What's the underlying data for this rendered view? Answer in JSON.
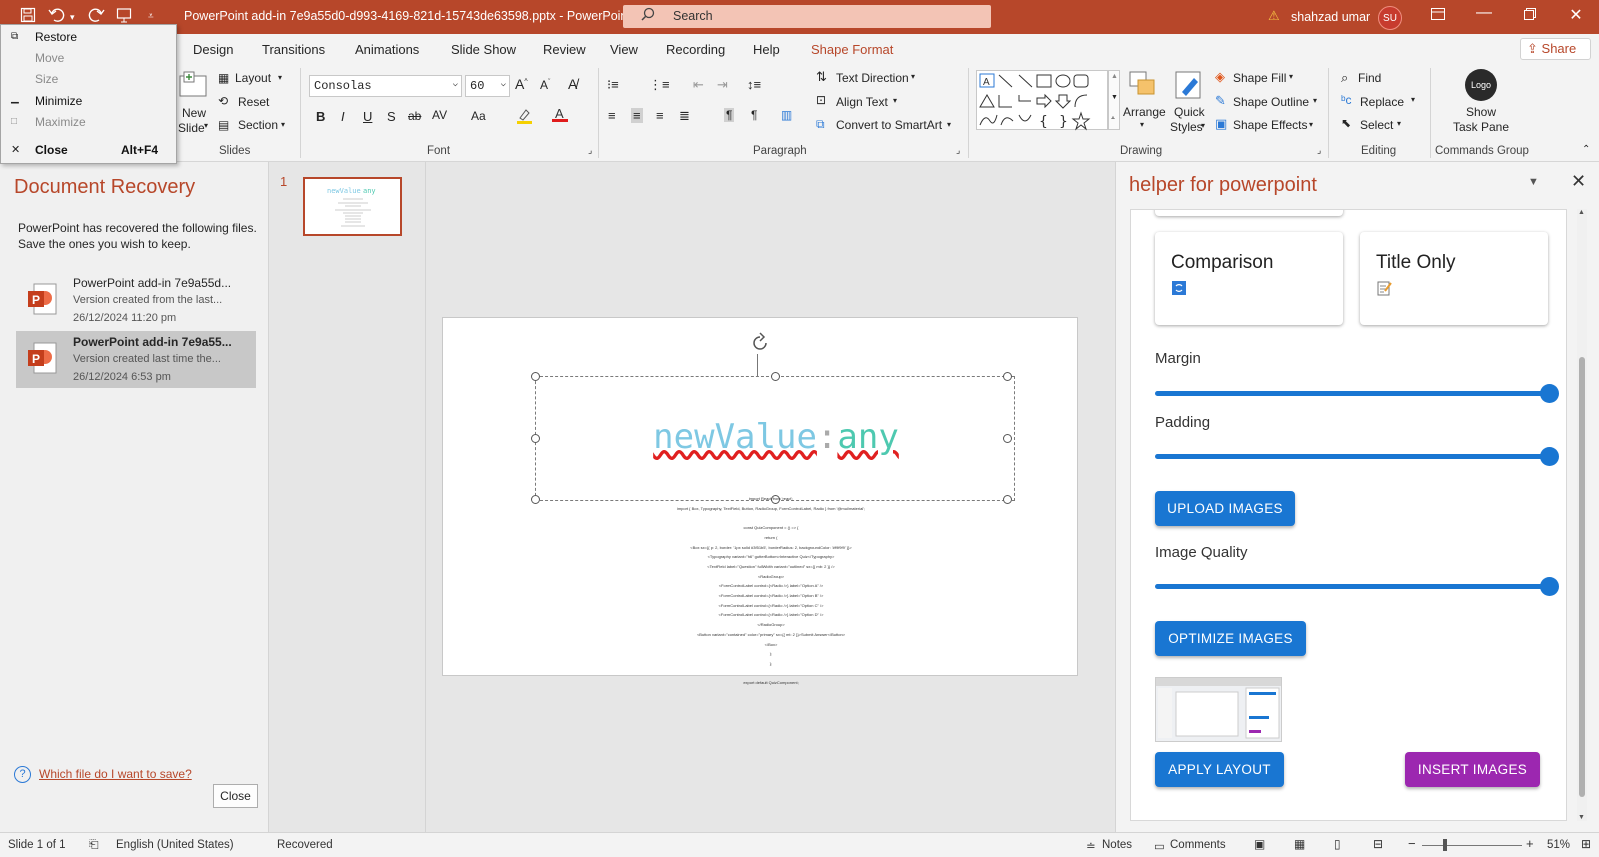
{
  "window": {
    "title": "PowerPoint add-in 7e9a55d0-d993-4169-821d-15743de63598.pptx  -  PowerPoint",
    "search_placeholder": "Search",
    "user_name": "shahzad umar",
    "user_initials": "SU",
    "accent_color": "#b7472a"
  },
  "system_menu": {
    "items": [
      {
        "label": "Restore",
        "accel": "",
        "enabled": true
      },
      {
        "label": "Move",
        "accel": "",
        "enabled": false
      },
      {
        "label": "Size",
        "accel": "",
        "enabled": false
      },
      {
        "label": "Minimize",
        "accel": "",
        "enabled": true
      },
      {
        "label": "Maximize",
        "accel": "",
        "enabled": false
      },
      {
        "label": "Close",
        "accel": "Alt+F4",
        "enabled": true
      }
    ]
  },
  "tabs": [
    {
      "label": "Design"
    },
    {
      "label": "Transitions"
    },
    {
      "label": "Animations"
    },
    {
      "label": "Slide Show"
    },
    {
      "label": "Review"
    },
    {
      "label": "View"
    },
    {
      "label": "Recording"
    },
    {
      "label": "Help"
    },
    {
      "label": "Shape Format"
    }
  ],
  "share_label": "Share",
  "ribbon": {
    "slides": {
      "new_slide": "New",
      "new_slide2": "Slide",
      "layout": "Layout",
      "reset": "Reset",
      "section": "Section",
      "group": "Slides"
    },
    "font": {
      "font_name": "Consolas",
      "font_size": "60",
      "group": "Font"
    },
    "paragraph": {
      "text_direction": "Text Direction",
      "align_text": "Align Text",
      "convert_smartart": "Convert to SmartArt",
      "group": "Paragraph"
    },
    "drawing": {
      "arrange": "Arrange",
      "quick_styles": "Quick",
      "quick_styles2": "Styles",
      "shape_fill": "Shape Fill",
      "shape_outline": "Shape Outline",
      "shape_effects": "Shape Effects",
      "group": "Drawing"
    },
    "editing": {
      "find": "Find",
      "replace": "Replace",
      "select": "Select",
      "group": "Editing"
    },
    "commands": {
      "logo": "Logo",
      "show": "Show",
      "task_pane": "Task Pane",
      "group": "Commands Group"
    }
  },
  "recovery": {
    "title": "Document Recovery",
    "description": "PowerPoint has recovered the following files.  Save the ones you wish to keep.",
    "files": [
      {
        "name": "PowerPoint add-in 7e9a55d...",
        "desc": "Version created from the last...",
        "date": "26/12/2024 11:20 pm"
      },
      {
        "name": "PowerPoint add-in 7e9a55...",
        "desc": "Version created last time the...",
        "date": "26/12/2024 6:53 pm"
      }
    ],
    "help_link": "Which file do I want to save?",
    "close_label": "Close"
  },
  "thumbnail": {
    "number": "1"
  },
  "slide": {
    "title_part1": "newValue",
    "title_colon": ":",
    "title_part2": "any",
    "code_lines": [
      "import React from 'react';",
      "import { Box, Typography, TextField, Button, RadioGroup, FormControlLabel, Radio } from '@mui/material';",
      "",
      "const QuizComponent = () => {",
      "return (",
      "<Box sx={{ p: 2, border: '1px solid #3f51b5', borderRadius: 2, backgroundColor: '#f9f9f9' }}>",
      "<Typography variant=\"h6\" gutterBottom>Interactive Quiz</Typography>",
      "<TextField label=\"Question\" fullWidth variant=\"outlined\" sx={{ mb: 2 }} />",
      "<RadioGroup>",
      "<FormControlLabel control={<Radio />} label=\"Option A\" />",
      "<FormControlLabel control={<Radio />} label=\"Option B\" />",
      "<FormControlLabel control={<Radio />} label=\"Option C\" />",
      "<FormControlLabel control={<Radio />} label=\"Option D\" />",
      "</RadioGroup>",
      "<Button variant=\"contained\" color=\"primary\" sx={{ mt: 2 }}>Submit Answer</Button>",
      "</Box>",
      ");",
      "};",
      "",
      "export default QuizComponent;"
    ]
  },
  "taskpane": {
    "title": "helper for powerpoint",
    "layout_cards": [
      {
        "label": "Comparison"
      },
      {
        "label": "Title Only"
      }
    ],
    "sliders": [
      {
        "label": "Margin",
        "value_fraction": 1.0
      },
      {
        "label": "Padding",
        "value_fraction": 1.0
      },
      {
        "label": "Image Quality",
        "value_fraction": 1.0
      }
    ],
    "upload_button": "UPLOAD IMAGES",
    "optimize_button": "OPTIMIZE IMAGES",
    "apply_button": "APPLY LAYOUT",
    "insert_button": "INSERT IMAGES",
    "primary_color": "#1976d2",
    "secondary_color": "#9c27b0"
  },
  "status": {
    "slide_count": "Slide 1 of 1",
    "language": "English (United States)",
    "state": "Recovered",
    "notes": "Notes",
    "comments": "Comments",
    "zoom": "51%"
  }
}
